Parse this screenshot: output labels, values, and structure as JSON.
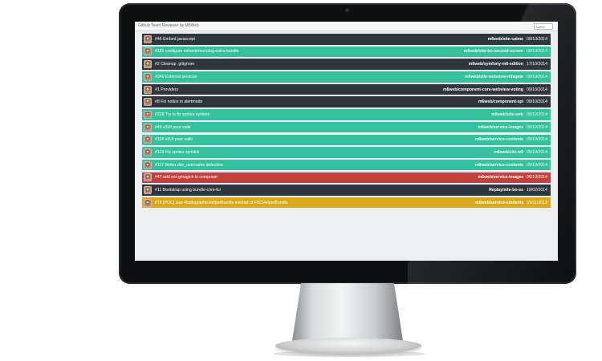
{
  "app": {
    "title": "Github Team Reviewer by M6Web",
    "search_placeholder": "Author"
  },
  "colors": {
    "dark": "#2e3640",
    "teal": "#35c1a0",
    "red": "#c2403d",
    "yellow": "#d9a91b"
  },
  "pull_requests": [
    {
      "title": "#46 Embed javascript",
      "repo": "m6web/site-calme",
      "date": "09/10/2014",
      "status": "dark"
    },
    {
      "title": "#181 configure m6web/monolog-extra-bundle",
      "repo": "m6web/site-bo-second-screen",
      "date": "09/10/2014",
      "status": "teal"
    },
    {
      "title": "#2 Cleanup .gitignore",
      "repo": "m6web/symfony-m6-edition",
      "date": "17/10/2014",
      "status": "dark"
    },
    {
      "title": "#240 External services",
      "repo": "m6web/site-webview-ridagate",
      "date": "09/10/2014",
      "status": "teal"
    },
    {
      "title": "#1 Providers",
      "repo": "m6web/component-core-webview-voting",
      "date": "09/10/2014",
      "status": "dark"
    },
    {
      "title": "#8 Fix notice in alertmodo",
      "repo": "m6web/component-spi",
      "date": "09/10/2014",
      "status": "dark"
    },
    {
      "title": "#228 Try to fix sprites symlink",
      "repo": "m6web/site-web",
      "date": "09/10/2014",
      "status": "teal"
    },
    {
      "title": "#49 s3Uf pour salle",
      "repo": "m6web/service-images",
      "date": "09/10/2014",
      "status": "teal"
    },
    {
      "title": "#118 s3Uf pour salle",
      "repo": "m6web/service-contents",
      "date": "09/10/2014",
      "status": "teal"
    },
    {
      "title": "#123 Fix sprites symlink",
      "repo": "m6web/site-w9",
      "date": "09/10/2014",
      "status": "teal"
    },
    {
      "title": "#117 Better dav_username detection",
      "repo": "m6web/service-contents",
      "date": "09/10/2014",
      "status": "teal"
    },
    {
      "title": "#47 add ext-gmagick to composer",
      "repo": "m6web/service-images",
      "date": "09/10/2014",
      "status": "red"
    },
    {
      "title": "#11 Bootstrap using bundle-core-bo",
      "repo": "Replay/site-bo-ss",
      "date": "19/02/2014",
      "status": "dark"
    },
    {
      "title": "#78 [POC] Use RadiographicHelperBundle instead of FSCHelperBundle",
      "repo": "m6web/service-contents",
      "date": "19/11/2013",
      "status": "yellow"
    }
  ]
}
